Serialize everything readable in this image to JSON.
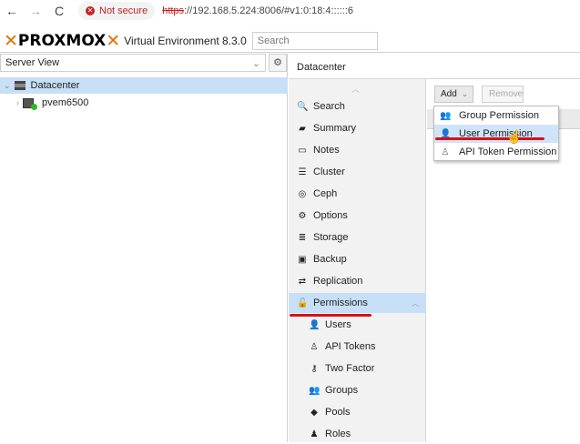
{
  "browser": {
    "back_icon": "←",
    "forward_icon": "→",
    "reload_icon": "C",
    "security_text": "Not secure",
    "url_scheme": "https",
    "url_rest": "://192.168.5.224:8006/#v1:0:18:4::::::6"
  },
  "header": {
    "logo": "PROXMOX",
    "product": "Virtual Environment 8.3.0",
    "search_placeholder": "Search"
  },
  "left": {
    "view": "Server View",
    "tree": {
      "datacenter": "Datacenter",
      "node": "pvem6500"
    }
  },
  "right": {
    "breadcrumb": "Datacenter",
    "menu": [
      {
        "label": "Search"
      },
      {
        "label": "Summary"
      },
      {
        "label": "Notes"
      },
      {
        "label": "Cluster"
      },
      {
        "label": "Ceph"
      },
      {
        "label": "Options"
      },
      {
        "label": "Storage"
      },
      {
        "label": "Backup"
      },
      {
        "label": "Replication"
      },
      {
        "label": "Permissions"
      },
      {
        "label": "Users"
      },
      {
        "label": "API Tokens"
      },
      {
        "label": "Two Factor"
      },
      {
        "label": "Groups"
      },
      {
        "label": "Pools"
      },
      {
        "label": "Roles"
      }
    ],
    "toolbar": {
      "add": "Add",
      "remove": "Remove"
    },
    "dropdown": [
      {
        "label": "Group Permission"
      },
      {
        "label": "User Permission"
      },
      {
        "label": "API Token Permission"
      }
    ]
  },
  "colors": {
    "accent": "#e57000",
    "selection": "#c7e0f7",
    "annotation": "#d8101a"
  }
}
